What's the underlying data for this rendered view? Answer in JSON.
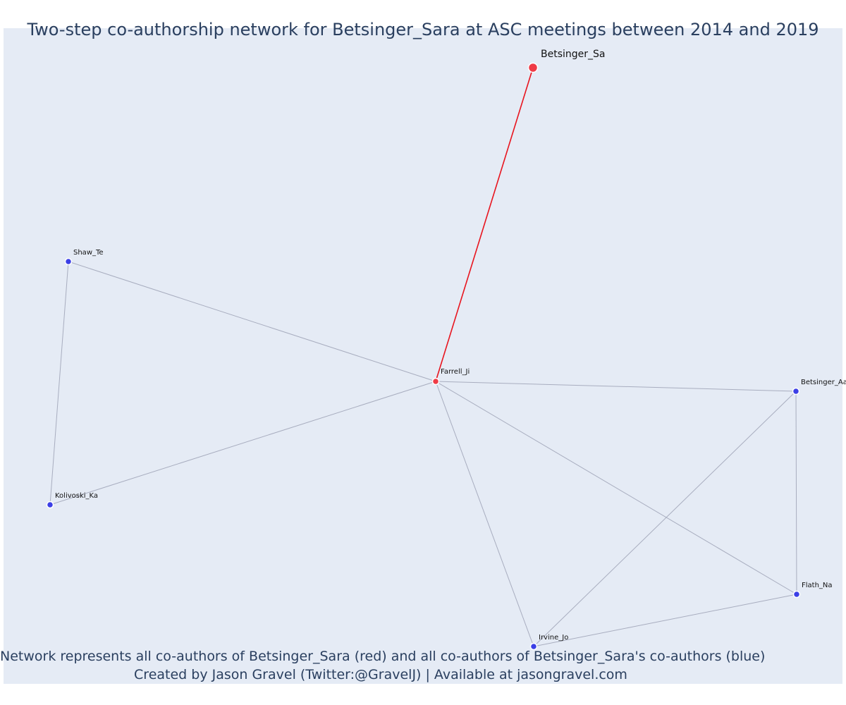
{
  "title": "Two-step co-authorship network for Betsinger_Sara at ASC meetings between 2014 and 2019",
  "caption": {
    "line1": "Network represents all co-authors of Betsinger_Sara (red) and all co-authors of Betsinger_Sara's co-authors (blue)",
    "line2": "Created by Jason Gravel (Twitter:@GravelJ) | Available at jasongravel.com"
  },
  "colors": {
    "red_node": "#ef3b46",
    "blue_node": "#3b3fe6",
    "red_edge": "#e8141e",
    "gray_edge": "#a8adbf",
    "plot_background": "#e5ebf5",
    "text": "#2a3f5f"
  },
  "nodes": [
    {
      "id": "Betsinger_Sa",
      "label": "Betsinger_Sa",
      "group": "focal"
    },
    {
      "id": "Farrell_Ji",
      "label": "Farrell_Ji",
      "group": "red"
    },
    {
      "id": "Shaw_Te",
      "label": "Shaw_Te",
      "group": "blue"
    },
    {
      "id": "Kolivoski_Ka",
      "label": "Kolivoski_Ka",
      "group": "blue"
    },
    {
      "id": "Betsinger_Aa",
      "label": "Betsinger_Aa",
      "group": "blue"
    },
    {
      "id": "Flath_Na",
      "label": "Flath_Na",
      "group": "blue"
    },
    {
      "id": "Irvine_Jo",
      "label": "Irvine_Jo",
      "group": "blue"
    }
  ],
  "edges": [
    {
      "source": "Betsinger_Sa",
      "target": "Farrell_Ji",
      "kind": "red"
    },
    {
      "source": "Farrell_Ji",
      "target": "Shaw_Te",
      "kind": "gray"
    },
    {
      "source": "Farrell_Ji",
      "target": "Kolivoski_Ka",
      "kind": "gray"
    },
    {
      "source": "Shaw_Te",
      "target": "Kolivoski_Ka",
      "kind": "gray"
    },
    {
      "source": "Farrell_Ji",
      "target": "Betsinger_Aa",
      "kind": "gray"
    },
    {
      "source": "Farrell_Ji",
      "target": "Flath_Na",
      "kind": "gray"
    },
    {
      "source": "Farrell_Ji",
      "target": "Irvine_Jo",
      "kind": "gray"
    },
    {
      "source": "Betsinger_Aa",
      "target": "Flath_Na",
      "kind": "gray"
    },
    {
      "source": "Betsinger_Aa",
      "target": "Irvine_Jo",
      "kind": "gray"
    },
    {
      "source": "Irvine_Jo",
      "target": "Flath_Na",
      "kind": "gray"
    }
  ]
}
